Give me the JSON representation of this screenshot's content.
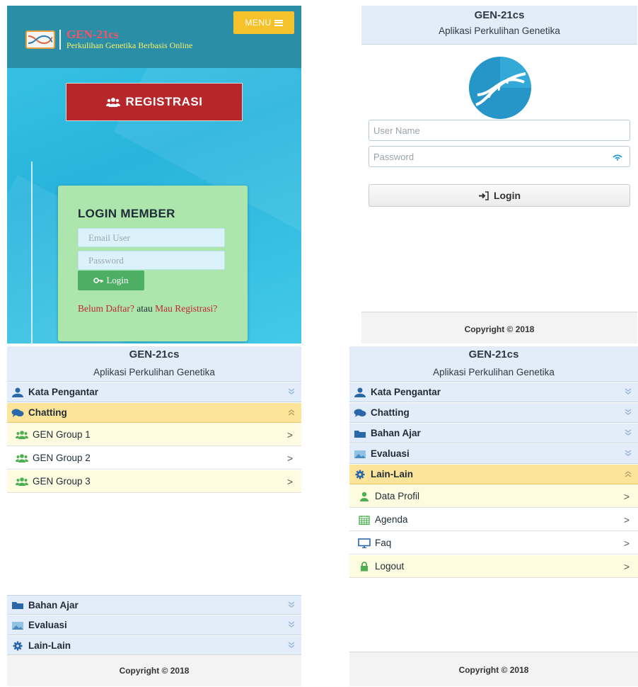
{
  "landing": {
    "menu_label": "MENU",
    "brand_title": "GEN-21cs",
    "brand_subtitle": "Perkulihan Genetika Berbasis Online",
    "register_label": "REGISTRASI",
    "login_title": "LOGIN MEMBER",
    "email_placeholder": "Email User",
    "password_placeholder": "Password",
    "login_label": "Login",
    "register_prompt_1": "Belum Daftar?",
    "register_prompt_2": " atau ",
    "register_prompt_3": "Mau Registrasi?"
  },
  "app": {
    "title": "GEN-21cs",
    "subtitle": "Aplikasi Perkulihan Genetika",
    "footer": "Copyright © 2018"
  },
  "login_screen": {
    "username_placeholder": "User Name",
    "password_placeholder": "Password",
    "login_label": "Login"
  },
  "menu": {
    "kata_pengantar": "Kata Pengantar",
    "chatting": "Chatting",
    "bahan_ajar": "Bahan Ajar",
    "evaluasi": "Evaluasi",
    "lain_lain": "Lain-Lain"
  },
  "chat_groups": [
    "GEN Group 1",
    "GEN Group 2",
    "GEN Group 3"
  ],
  "lain_items": [
    "Data Profil",
    "Agenda",
    "Faq",
    "Logout"
  ],
  "arrow": ">",
  "colors": {
    "landing_bg": "#2fbde3",
    "topbar": "#2a8fa6",
    "menu_button": "#f5c22b",
    "register_button": "#b7262a",
    "login_card": "#ace6ad",
    "header_bg": "#e3edfa",
    "active_section": "#fce59a"
  }
}
